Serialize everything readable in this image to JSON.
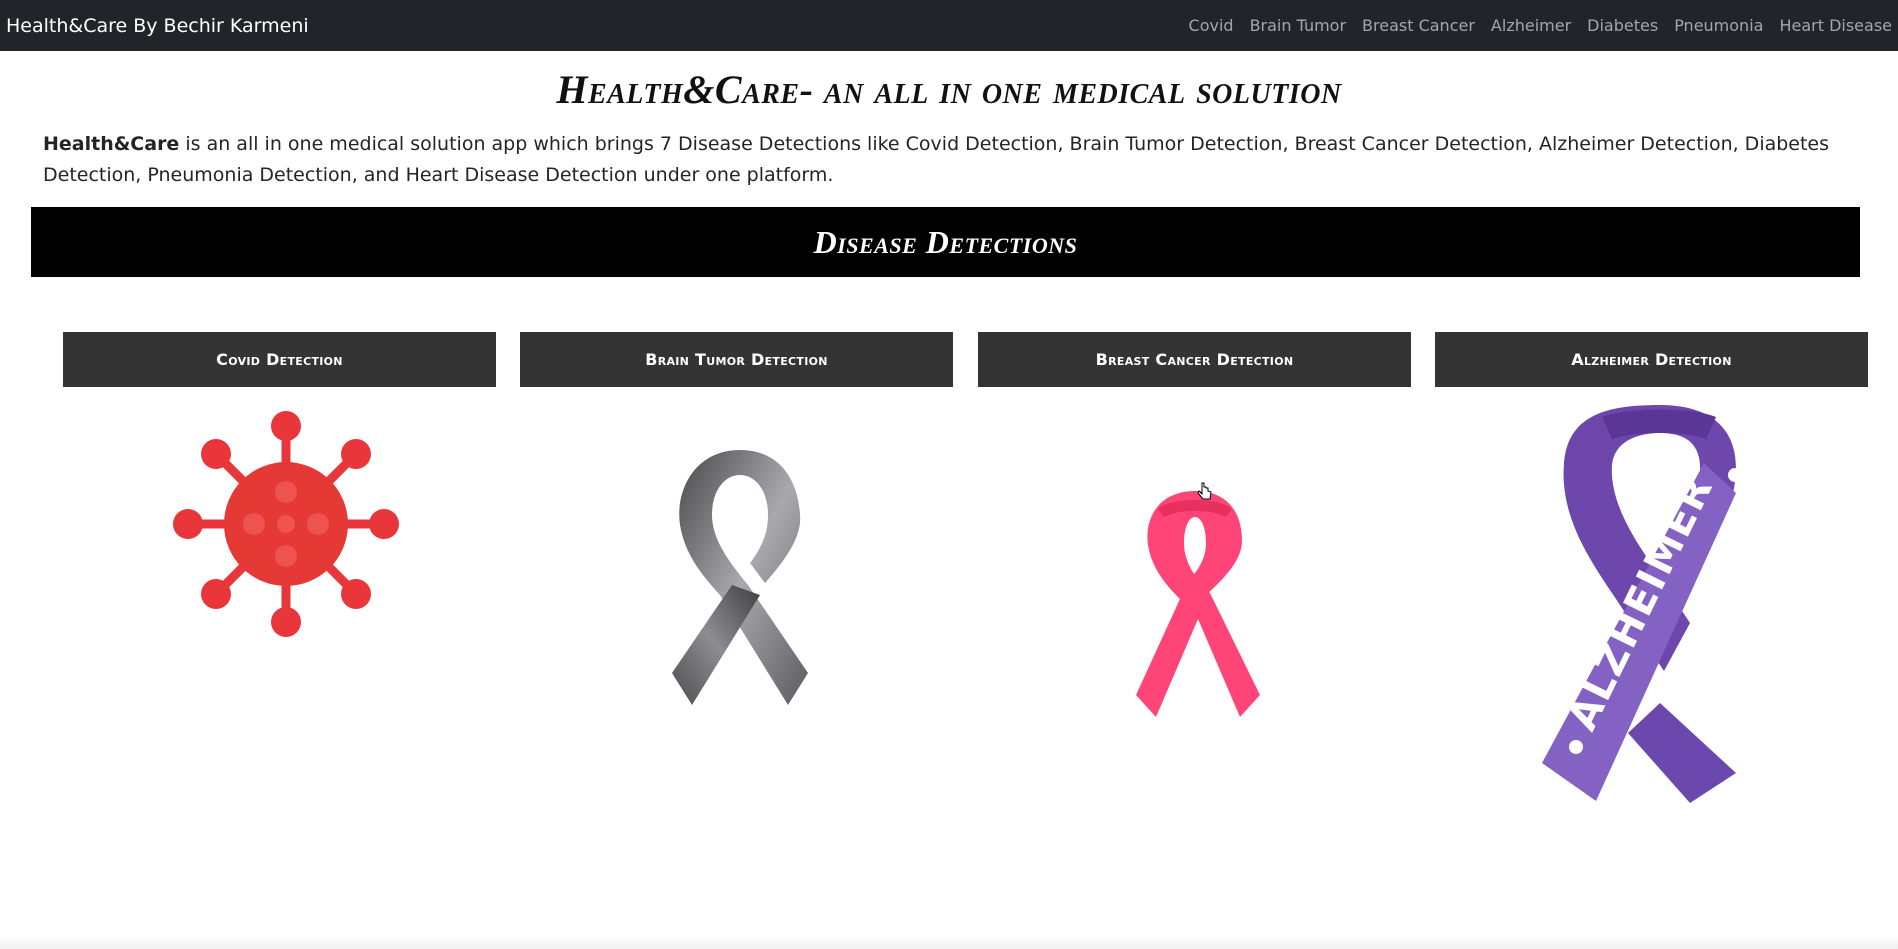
{
  "navbar": {
    "brand": "Health&Care By Bechir Karmeni",
    "links": [
      "Covid",
      "Brain Tumor",
      "Breast Cancer",
      "Alzheimer",
      "Diabetes",
      "Pneumonia",
      "Heart Disease"
    ]
  },
  "hero": {
    "title": "Health&Care- an all in one medical solution",
    "intro_bold": "Health&Care",
    "intro_text": " is an all in one medical solution app which brings 7 Disease Detections like Covid Detection, Brain Tumor Detection, Breast Cancer Detection, Alzheimer Detection, Diabetes Detection, Pneumonia Detection, and Heart Disease Detection under one platform."
  },
  "section": {
    "title": "Disease Detections"
  },
  "cards": [
    {
      "title": "Covid Detection",
      "icon": "covid-virus-icon"
    },
    {
      "title": "Brain Tumor Detection",
      "icon": "gray-ribbon-icon"
    },
    {
      "title": "Breast Cancer Detection",
      "icon": "pink-ribbon-icon"
    },
    {
      "title": "Alzheimer Detection",
      "icon": "purple-ribbon-icon",
      "ribbon_text": "ALZHEIMER"
    }
  ],
  "colors": {
    "navbar_bg": "#212429",
    "banner_bg": "#000000",
    "card_header_bg": "#343434",
    "covid_red": "#e53935",
    "ribbon_gray": "#6b6b6e",
    "ribbon_pink": "#ff4577",
    "ribbon_purple": "#7b57b8"
  }
}
